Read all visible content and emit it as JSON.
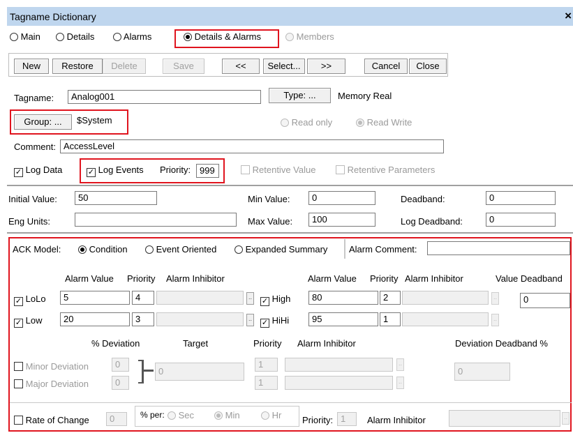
{
  "window": {
    "title": "Tagname Dictionary",
    "close_glyph": "×"
  },
  "tabs": {
    "main": "Main",
    "details": "Details",
    "alarms": "Alarms",
    "details_alarms": "Details & Alarms",
    "members": "Members"
  },
  "toolbar": {
    "new": "New",
    "restore": "Restore",
    "delete": "Delete",
    "save": "Save",
    "prev": "<<",
    "select": "Select...",
    "next": ">>",
    "cancel": "Cancel",
    "close": "Close"
  },
  "tag": {
    "tagname_label": "Tagname:",
    "tagname_value": "Analog001",
    "type_button": "Type: ...",
    "type_value": "Memory Real",
    "group_button": "Group: ...",
    "group_value": "$System",
    "read_only": "Read only",
    "read_write": "Read Write",
    "comment_label": "Comment:",
    "comment_value": "AccessLevel",
    "log_data": "Log Data",
    "log_events": "Log Events",
    "priority_label": "Priority:",
    "priority_value": "999",
    "retentive_value": "Retentive Value",
    "retentive_parameters": "Retentive Parameters"
  },
  "values": {
    "initial_label": "Initial Value:",
    "initial_value": "50",
    "eng_units_label": "Eng Units:",
    "eng_units_value": "",
    "min_label": "Min Value:",
    "min_value": "0",
    "max_label": "Max Value:",
    "max_value": "100",
    "deadband_label": "Deadband:",
    "deadband_value": "0",
    "log_deadband_label": "Log Deadband:",
    "log_deadband_value": "0"
  },
  "alarms": {
    "ack_model_label": "ACK Model:",
    "condition": "Condition",
    "event_oriented": "Event Oriented",
    "expanded_summary": "Expanded Summary",
    "alarm_comment_label": "Alarm Comment:",
    "alarm_comment_value": "",
    "col_alarm_value": "Alarm Value",
    "col_priority": "Priority",
    "col_inhibitor": "Alarm Inhibitor",
    "col_value_deadband": "Value Deadband",
    "lolo": "LoLo",
    "lolo_value": "5",
    "lolo_priority": "4",
    "low": "Low",
    "low_value": "20",
    "low_priority": "3",
    "high": "High",
    "high_value": "80",
    "high_priority": "2",
    "hihi": "HiHi",
    "hihi_value": "95",
    "hihi_priority": "1",
    "value_deadband": "0",
    "inhibitor_button": ".."
  },
  "deviation": {
    "col_pct": "% Deviation",
    "col_target": "Target",
    "col_priority": "Priority",
    "col_inhibitor": "Alarm Inhibitor",
    "col_deadband": "Deviation Deadband %",
    "minor": "Minor Deviation",
    "minor_pct": "0",
    "minor_priority": "1",
    "major": "Major Deviation",
    "major_pct": "0",
    "major_priority": "1",
    "target_value": "0",
    "deadband_value": "0"
  },
  "roc": {
    "label": "Rate of Change",
    "value": "0",
    "per_label": "% per:",
    "sec": "Sec",
    "min": "Min",
    "hr": "Hr",
    "priority_label": "Priority:",
    "priority_value": "1",
    "inhibitor_label": "Alarm Inhibitor"
  },
  "colors": {
    "title_bg": "#bfd6ee",
    "highlight": "#e0141e"
  }
}
